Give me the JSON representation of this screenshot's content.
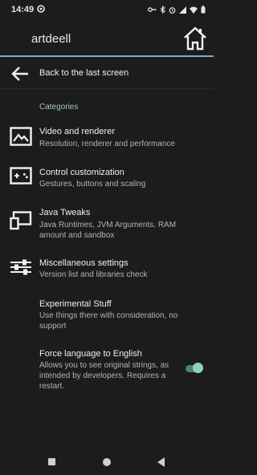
{
  "status": {
    "time": "14:49"
  },
  "appbar": {
    "title": "artdeell"
  },
  "back": {
    "label": "Back to the last screen"
  },
  "categories_header": "Categories",
  "items": [
    {
      "title": "Video and renderer",
      "summary": "Resolution, renderer and performance",
      "icon": "image-icon"
    },
    {
      "title": "Control customization",
      "summary": "Gestures, buttons and scaling",
      "icon": "gamepad-icon"
    },
    {
      "title": "Java Tweaks",
      "summary": "Java Runtimes, JVM Arguments, RAM amount and sandbox",
      "icon": "computer-icon"
    },
    {
      "title": "Miscellaneous settings",
      "summary": "Version list and libraries check",
      "icon": "sliders-icon"
    },
    {
      "title": "Experimental Stuff",
      "summary": "Use things there with consideration, no support"
    },
    {
      "title": "Force language to English",
      "summary": "Allows you to see original strings, as intended by developers. Requires a restart.",
      "toggle_on": true
    }
  ]
}
